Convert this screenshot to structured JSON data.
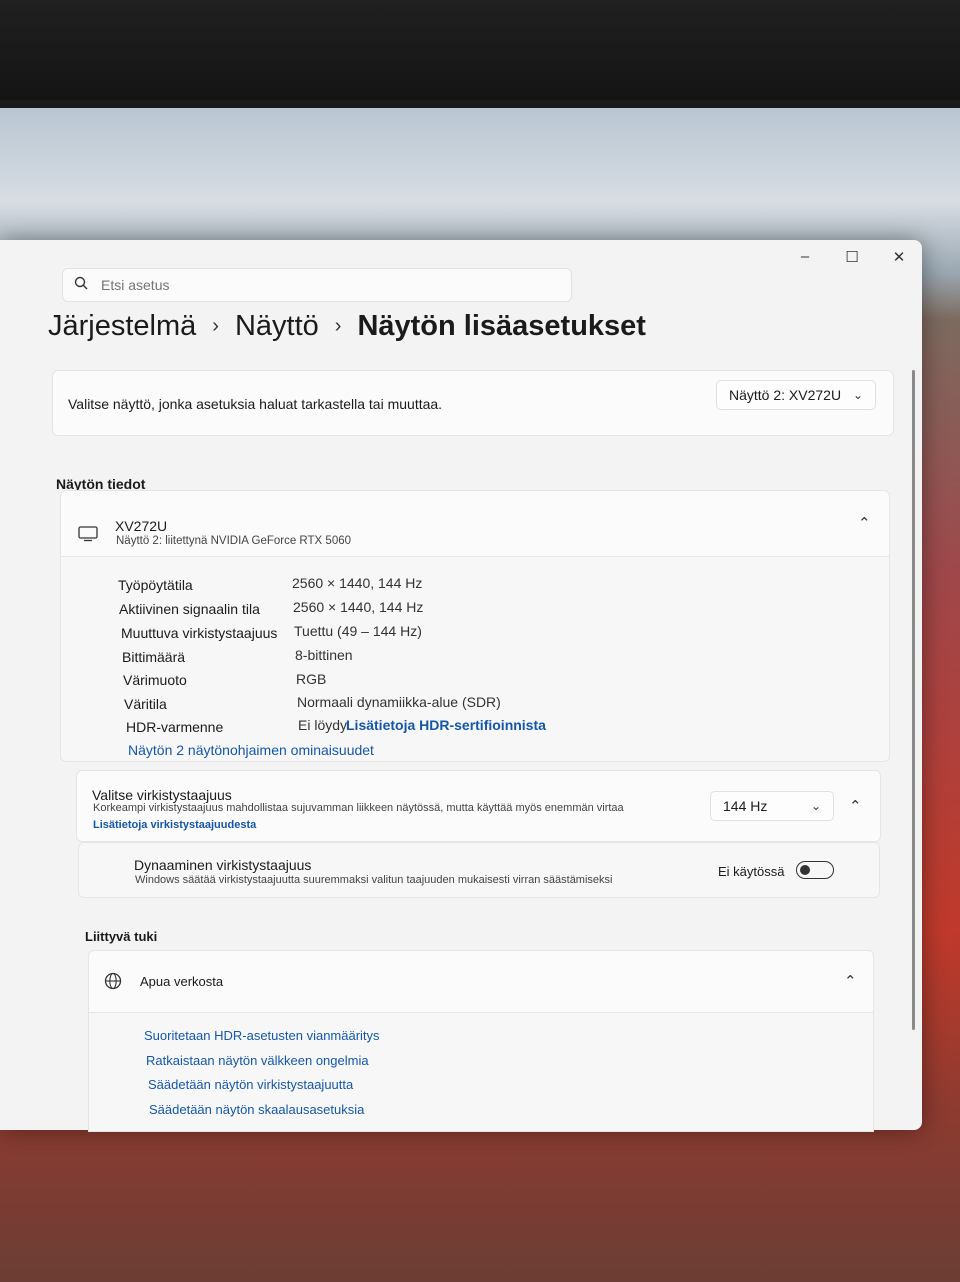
{
  "window_controls": {
    "minimize": "–",
    "maximize": "☐",
    "close": "✕"
  },
  "search": {
    "placeholder": "Etsi asetus"
  },
  "breadcrumb": {
    "level1": "Järjestelmä",
    "level2": "Näyttö",
    "level3": "Näytön lisäasetukset"
  },
  "display_select": {
    "description": "Valitse näyttö, jonka asetuksia haluat tarkastella tai muuttaa.",
    "selected": "Näyttö 2: XV272U"
  },
  "display_info": {
    "section_title": "Näytön tiedot",
    "monitor_name": "XV272U",
    "monitor_subtitle": "Näyttö 2: liitettynä NVIDIA GeForce RTX 5060",
    "rows": [
      {
        "label": "Työpöytätila",
        "value": "2560 × 1440, 144 Hz"
      },
      {
        "label": "Aktiivinen signaalin tila",
        "value": "2560 × 1440, 144 Hz"
      },
      {
        "label": "Muuttuva virkistystaajuus",
        "value": "Tuettu (49 – 144 Hz)"
      },
      {
        "label": "Bittimäärä",
        "value": "8-bittinen"
      },
      {
        "label": "Värimuoto",
        "value": "RGB"
      },
      {
        "label": "Väritila",
        "value": "Normaali dynamiikka-alue (SDR)"
      },
      {
        "label": "HDR-varmenne",
        "value": "Ei löydy",
        "link": "Lisätietoja HDR-sertifioinnista"
      }
    ],
    "adapter_link": "Näytön 2 näytönohjaimen ominaisuudet"
  },
  "refresh_rate": {
    "title": "Valitse virkistystaajuus",
    "description": "Korkeampi virkistystaajuus mahdollistaa sujuvamman liikkeen näytössä, mutta käyttää myös enemmän virtaa",
    "link": "Lisätietoja virkistystaajuudesta",
    "selected": "144 Hz"
  },
  "dynamic_refresh": {
    "title": "Dynaaminen virkistystaajuus",
    "description": "Windows säätää virkistystaajuutta suuremmaksi valitun taajuuden mukaisesti virran säästämiseksi",
    "state_label": "Ei käytössä",
    "enabled": false
  },
  "related_support": {
    "section_title": "Liittyvä tuki",
    "help_title": "Apua verkosta",
    "links": [
      "Suoritetaan HDR-asetusten vianmääritys",
      "Ratkaistaan näytön välkkeen ongelmia",
      "Säädetään näytön virkistystaajuutta",
      "Säädetään näytön skaalausasetuksia"
    ]
  },
  "colors": {
    "accent_link": "#1457a8",
    "window_bg": "#f3f3f3",
    "card_bg": "#fbfbfb"
  }
}
